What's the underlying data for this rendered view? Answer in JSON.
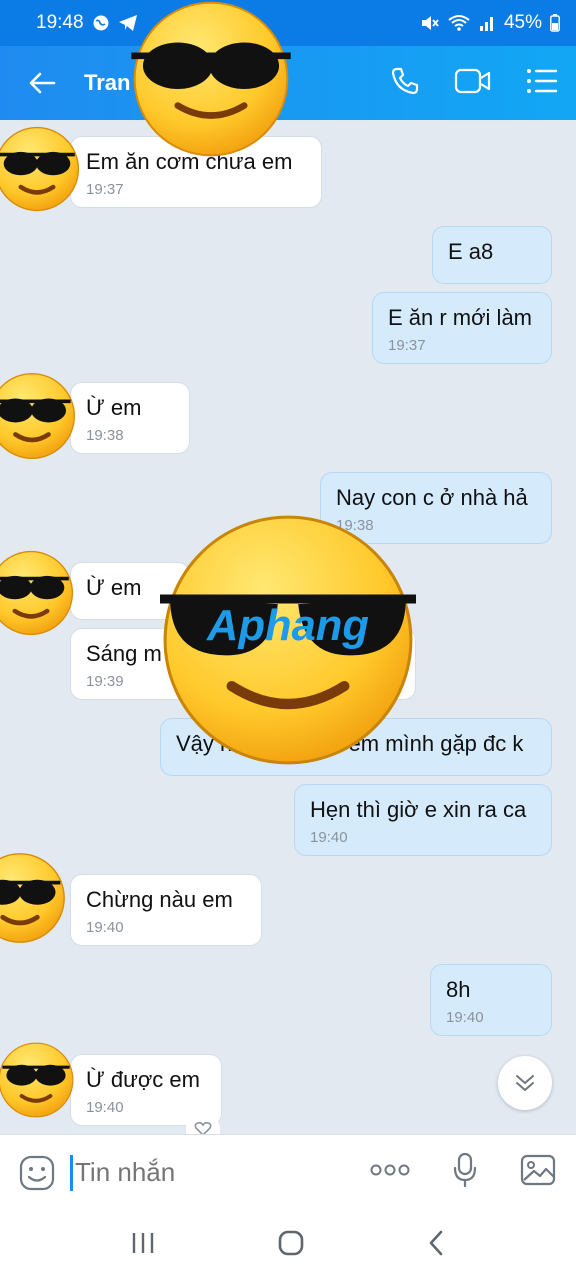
{
  "status_bar": {
    "time": "19:48",
    "battery": "45%"
  },
  "header": {
    "contact_name": "Tran",
    "icons": [
      "back-arrow-icon",
      "phone-icon",
      "video-call-icon",
      "menu-list-icon"
    ]
  },
  "messages": [
    {
      "dir": "in",
      "text": "Em ăn cơm chưa em",
      "time": "19:37"
    },
    {
      "dir": "out",
      "text": "E a8",
      "time": ""
    },
    {
      "dir": "out",
      "text": "E ăn r mới làm",
      "time": "19:37"
    },
    {
      "dir": "in",
      "text": "Ừ em",
      "time": "19:38"
    },
    {
      "dir": "out",
      "text": "Nay con c ở nhà hả",
      "time": "19:38"
    },
    {
      "dir": "in",
      "text": "Ừ em",
      "time": ""
    },
    {
      "dir": "in",
      "text": "Sáng m",
      "time": "19:39"
    },
    {
      "dir": "out",
      "text": "Vậy n",
      "text2": "em mình gặp đc k",
      "time": ""
    },
    {
      "dir": "out",
      "text": "Hẹn thì giờ e xin ra ca",
      "time": "19:40"
    },
    {
      "dir": "in",
      "text": "Chừng nàu em",
      "time": "19:40"
    },
    {
      "dir": "out",
      "text": "8h",
      "time": "19:40"
    },
    {
      "dir": "in",
      "text": "Ừ được em",
      "time": "19:40"
    }
  ],
  "composer": {
    "placeholder": "Tin nhắn",
    "icons": [
      "emoji-icon",
      "more-options-icon",
      "microphone-icon",
      "image-icon"
    ]
  },
  "watermark": {
    "text": "Aphang"
  },
  "colors": {
    "header": "#1f8bf0",
    "bubble_out": "#d5ebfc",
    "bubble_in": "#ffffff",
    "chat_bg": "#e2e9f1"
  }
}
